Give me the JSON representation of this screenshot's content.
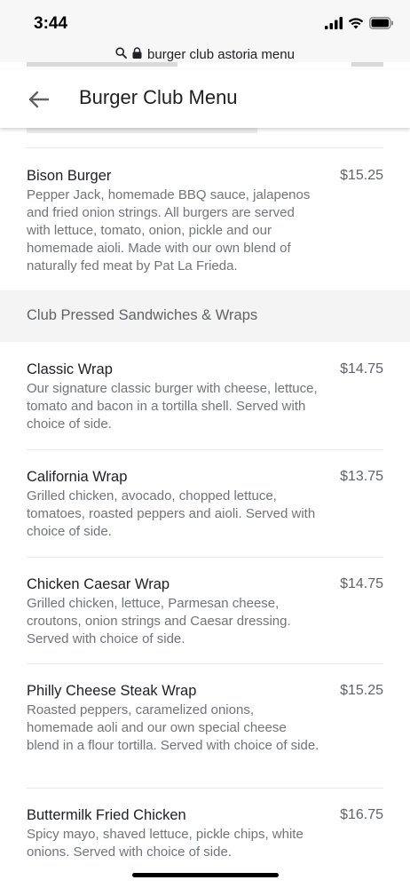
{
  "status": {
    "time": "3:44"
  },
  "browser": {
    "url": "burger club astoria menu"
  },
  "header": {
    "title": "Burger Club Menu"
  },
  "sections": [
    {
      "name": "",
      "items": [
        {
          "name": "Bison Burger",
          "price": "$15.25",
          "description": "Pepper Jack, homemade BBQ sauce, jalapenos and fried onion strings. All burgers are served with lettuce, tomato, onion, pickle and our homemade aioli. Made with our own blend of naturally fed meat by Pat La Frieda."
        }
      ]
    },
    {
      "name": "Club Pressed Sandwiches & Wraps",
      "items": [
        {
          "name": "Classic Wrap",
          "price": "$14.75",
          "description": "Our signature classic burger with cheese, lettuce, tomato and bacon in a tortilla shell. Served with choice of side."
        },
        {
          "name": "California Wrap",
          "price": "$13.75",
          "description": "Grilled chicken, avocado, chopped lettuce, tomatoes, roasted peppers and aioli. Served with choice of side."
        },
        {
          "name": "Chicken Caesar Wrap",
          "price": "$14.75",
          "description": "Grilled chicken, lettuce, Parmesan cheese, croutons, onion strings and Caesar dressing. Served with choice of side."
        },
        {
          "name": "Philly Cheese Steak Wrap",
          "price": "$15.25",
          "description": "Roasted peppers, caramelized onions, homemade aoli and our own special cheese blend in a flour tortilla. Served with choice of side."
        },
        {
          "name": "Buttermilk Fried Chicken",
          "price": "$16.75",
          "description": "Spicy mayo, shaved lettuce, pickle chips, white onions. Served with choice of side."
        }
      ]
    }
  ]
}
